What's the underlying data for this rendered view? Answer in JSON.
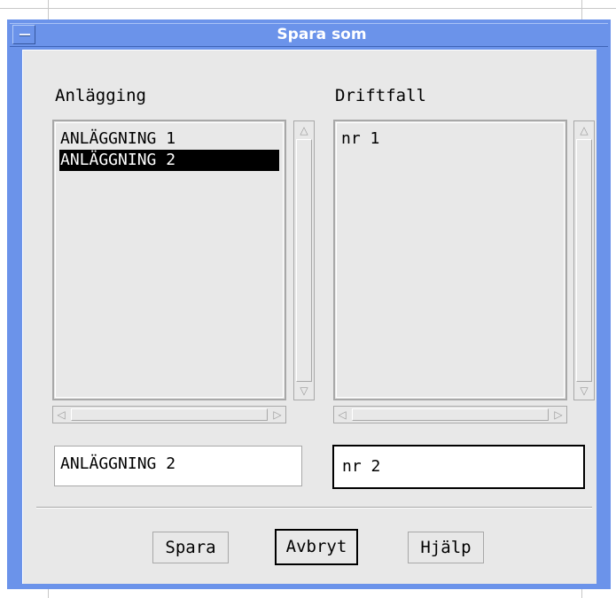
{
  "window": {
    "title": "Spara som"
  },
  "left_panel": {
    "label": "Anlägging",
    "items": [
      "ANLÄGGNING 1",
      "ANLÄGGNING 2"
    ],
    "selected_index": 1,
    "input_value": "ANLÄGGNING 2"
  },
  "right_panel": {
    "label": "Driftfall",
    "items": [
      "nr 1"
    ],
    "input_value": "nr 2"
  },
  "buttons": {
    "save": "Spara",
    "cancel": "Avbryt",
    "help": "Hjälp"
  },
  "icons": {
    "window_menu": "window-menu-icon",
    "scroll_up": "triangle-up-icon",
    "scroll_down": "triangle-down-icon",
    "scroll_left": "triangle-left-icon",
    "scroll_right": "triangle-right-icon"
  },
  "colors": {
    "titlebar": "#6b93ea",
    "dialog_bg": "#e8e8e8",
    "selection": "#000000"
  }
}
